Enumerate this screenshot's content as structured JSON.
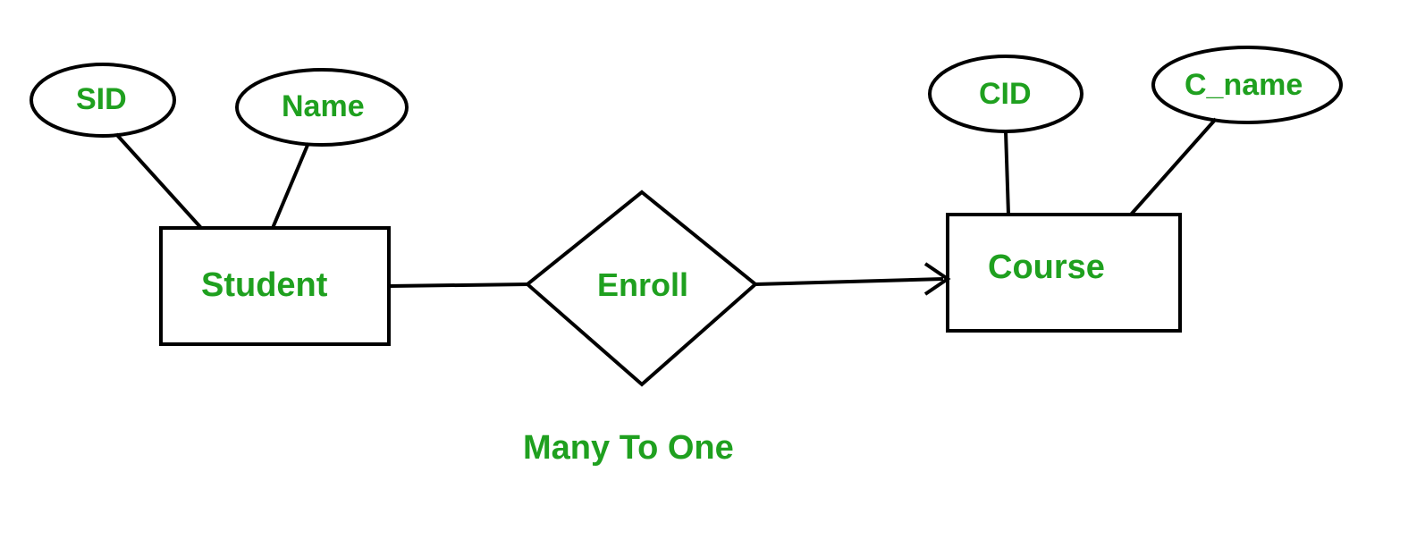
{
  "entities": {
    "student": {
      "label": "Student",
      "attributes": {
        "sid": "SID",
        "name": "Name"
      }
    },
    "course": {
      "label": "Course",
      "attributes": {
        "cid": "CID",
        "cname": "C_name"
      }
    }
  },
  "relationship": {
    "label": "Enroll"
  },
  "caption": "Many To One"
}
